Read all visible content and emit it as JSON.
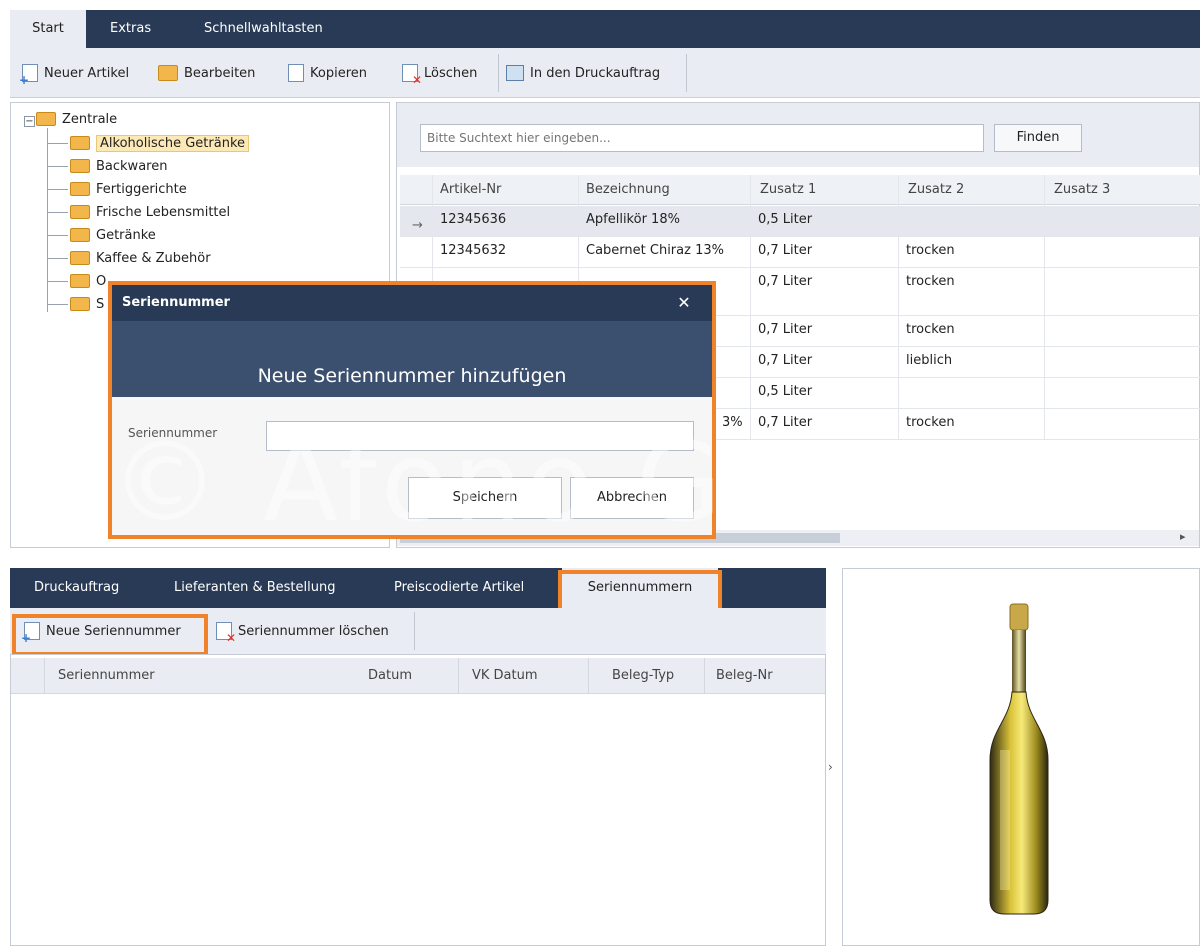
{
  "ribbon": {
    "tabs": [
      {
        "label": "Start"
      },
      {
        "label": "Extras"
      },
      {
        "label": "Schnellwahltasten"
      }
    ]
  },
  "toolbar": {
    "new_article": "Neuer Artikel",
    "edit": "Bearbeiten",
    "copy": "Kopieren",
    "delete": "Löschen",
    "print_job": "In den Druckauftrag"
  },
  "tree": {
    "root": "Zentrale",
    "items": [
      {
        "label": "Alkoholische Getränke"
      },
      {
        "label": "Backwaren"
      },
      {
        "label": "Fertiggerichte"
      },
      {
        "label": "Frische Lebensmittel"
      },
      {
        "label": "Getränke"
      },
      {
        "label": "Kaffee & Zubehör"
      },
      {
        "label": "O"
      },
      {
        "label": "S"
      }
    ]
  },
  "search": {
    "placeholder": "Bitte Suchtext hier eingeben...",
    "find_label": "Finden"
  },
  "grid": {
    "columns": [
      "Artikel-Nr",
      "Bezeichnung",
      "Zusatz 1",
      "Zusatz 2",
      "Zusatz 3"
    ],
    "rows": [
      {
        "nr": "12345636",
        "bez": "Apfellikör 18%",
        "z1": "0,5 Liter",
        "z2": "",
        "z3": ""
      },
      {
        "nr": "12345632",
        "bez": "Cabernet Chiraz 13%",
        "z1": "0,7 Liter",
        "z2": "trocken",
        "z3": ""
      },
      {
        "nr": "",
        "bez": "",
        "z1": "0,7 Liter",
        "z2": "trocken",
        "z3": ""
      },
      {
        "nr": "",
        "bez": "",
        "z1": "0,7 Liter",
        "z2": "trocken",
        "z3": ""
      },
      {
        "nr": "",
        "bez": "",
        "z1": "0,7 Liter",
        "z2": "lieblich",
        "z3": ""
      },
      {
        "nr": "",
        "bez": "",
        "z1": "0,5 Liter",
        "z2": "",
        "z3": ""
      },
      {
        "nr": "",
        "bez": "3%",
        "z1": "0,7 Liter",
        "z2": "trocken",
        "z3": ""
      }
    ]
  },
  "dialog": {
    "title": "Seriennummer",
    "close": "✕",
    "header": "Neue Seriennummer hinzufügen",
    "field_label": "Seriennummer",
    "field_value": "",
    "save": "Speichern",
    "cancel": "Abbrechen"
  },
  "watermark": "© Afono G",
  "bottom": {
    "tabs": [
      {
        "label": "Druckauftrag"
      },
      {
        "label": "Lieferanten & Bestellung"
      },
      {
        "label": "Preiscodierte Artikel"
      },
      {
        "label": "Seriennummern"
      }
    ],
    "new_serial": "Neue Seriennummer",
    "delete_serial": "Seriennummer löschen",
    "columns": [
      "Seriennummer",
      "Datum",
      "VK Datum",
      "Beleg-Typ",
      "Beleg-Nr"
    ]
  },
  "colors": {
    "ribbon": "#283a55",
    "toolbar": "#e9edf3",
    "highlight": "#f0832a",
    "dialog_header": "#3b4f6e"
  }
}
